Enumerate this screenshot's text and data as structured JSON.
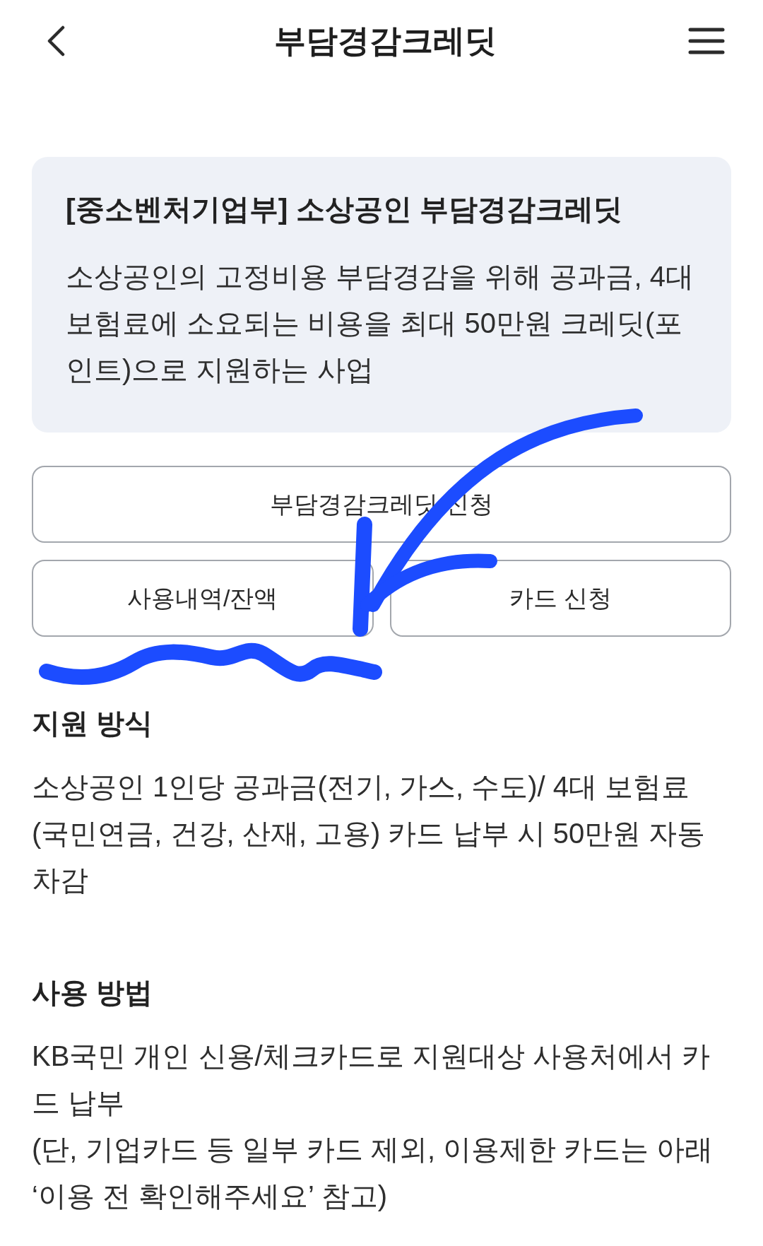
{
  "header": {
    "title": "부담경감크레딧"
  },
  "summary_card": {
    "title": "[중소벤처기업부] 소상공인 부담경감크레딧",
    "description": "소상공인의 고정비용 부담경감을 위해 공과금, 4대 보험료에 소요되는 비용을 최대 50만원 크레딧(포인트)으로 지원하는 사업"
  },
  "buttons": [
    {
      "label": "부담경감크레딧 신청"
    },
    {
      "label": "사용내역/잔액"
    },
    {
      "label": "카드 신청"
    }
  ],
  "sections": [
    {
      "heading": "지원 방식",
      "paragraphs": [
        "소상공인 1인당 공과금(전기, 가스, 수도)/ 4대 보험료(국민연금, 건강, 산재, 고용) 카드 납부 시 50만원 자동차감"
      ]
    },
    {
      "heading": "사용 방법",
      "paragraphs": [
        "KB국민 개인 신용/체크카드로 지원대상 사용처에서 카드 납부",
        "(단, 기업카드 등 일부 카드 제외, 이용제한 카드는 아래 ‘이용 전 확인해주세요’ 참고)"
      ]
    }
  ]
}
